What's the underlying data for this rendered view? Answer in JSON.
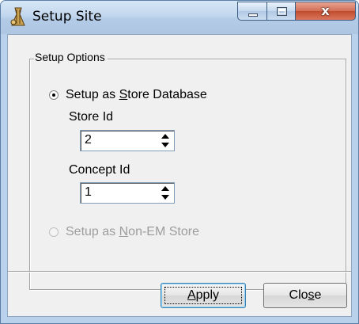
{
  "window": {
    "title": "Setup Site",
    "icon": "app-icon",
    "controls": {
      "minimize": "minimize-icon",
      "maximize": "maximize-icon",
      "close": "close-icon"
    }
  },
  "group": {
    "legend": "Setup Options"
  },
  "option_store": {
    "label_pre": "Setup as ",
    "label_accel": "S",
    "label_post": "tore Database",
    "selected": true
  },
  "store_id": {
    "label": "Store Id",
    "value": "2"
  },
  "concept_id": {
    "label": "Concept Id",
    "value": "1"
  },
  "option_non_em": {
    "label_pre": "Setup as ",
    "label_accel": "N",
    "label_post": "on-EM Store",
    "selected": false,
    "enabled": false
  },
  "buttons": {
    "apply": {
      "accel": "A",
      "rest": "pply"
    },
    "close": {
      "pre": "Clo",
      "accel": "s",
      "post": "e"
    }
  },
  "colors": {
    "accent": "#3c7fb1",
    "disabled_text": "#9d9d9d",
    "close_button": "#c24c2d"
  }
}
